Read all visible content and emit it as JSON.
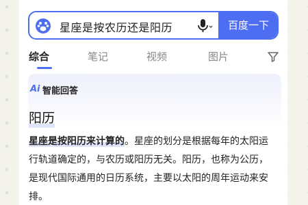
{
  "search": {
    "query": "星座是按农历还是阳历",
    "button_label": "百度一下"
  },
  "tabs": [
    {
      "label": "综合",
      "active": true
    },
    {
      "label": "笔记",
      "active": false
    },
    {
      "label": "视频",
      "active": false
    },
    {
      "label": "图片",
      "active": false
    }
  ],
  "ai_answer": {
    "icon_label": "Ai",
    "header": "智能回答",
    "title": "阳历",
    "body_highlight": "星座是按阳历来计算的",
    "body_rest": "。星座的划分是根据每年的太阳运行轨道确定的，与农历或阳历无关。阳历，也称为公历，是现代国际通用的日历系统，主要以太阳的周年运动来安排。"
  },
  "colors": {
    "accent": "#4e6ef2",
    "highlight": "#dfe4fb"
  },
  "icons": [
    "baidu-paw-icon",
    "microphone-icon",
    "filter-icon"
  ]
}
